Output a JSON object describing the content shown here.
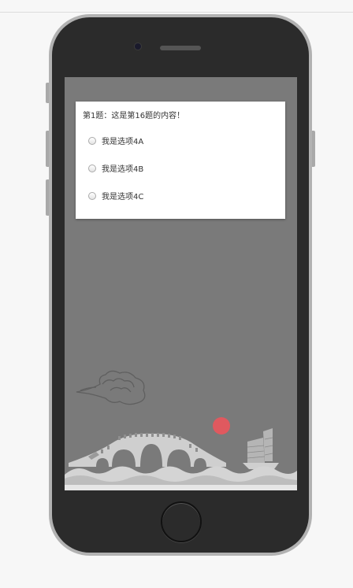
{
  "quiz": {
    "question": "第1题：这是第16题的内容！",
    "options": [
      {
        "label": "我是选项4A",
        "checked": false
      },
      {
        "label": "我是选项4B",
        "checked": false
      },
      {
        "label": "我是选项4C",
        "checked": false
      }
    ]
  },
  "colors": {
    "page_bg": "#f7f7f7",
    "phone_body": "#2b2b2b",
    "screen_bg": "#7a7a7a",
    "sun": "#e0595f",
    "scenery": "#cfcfcf"
  },
  "icons": [
    "camera-icon",
    "speaker-icon",
    "home-button-icon",
    "cloud-icon",
    "sun-icon",
    "bridge-icon",
    "junk-boat-icon",
    "waves-icon"
  ]
}
